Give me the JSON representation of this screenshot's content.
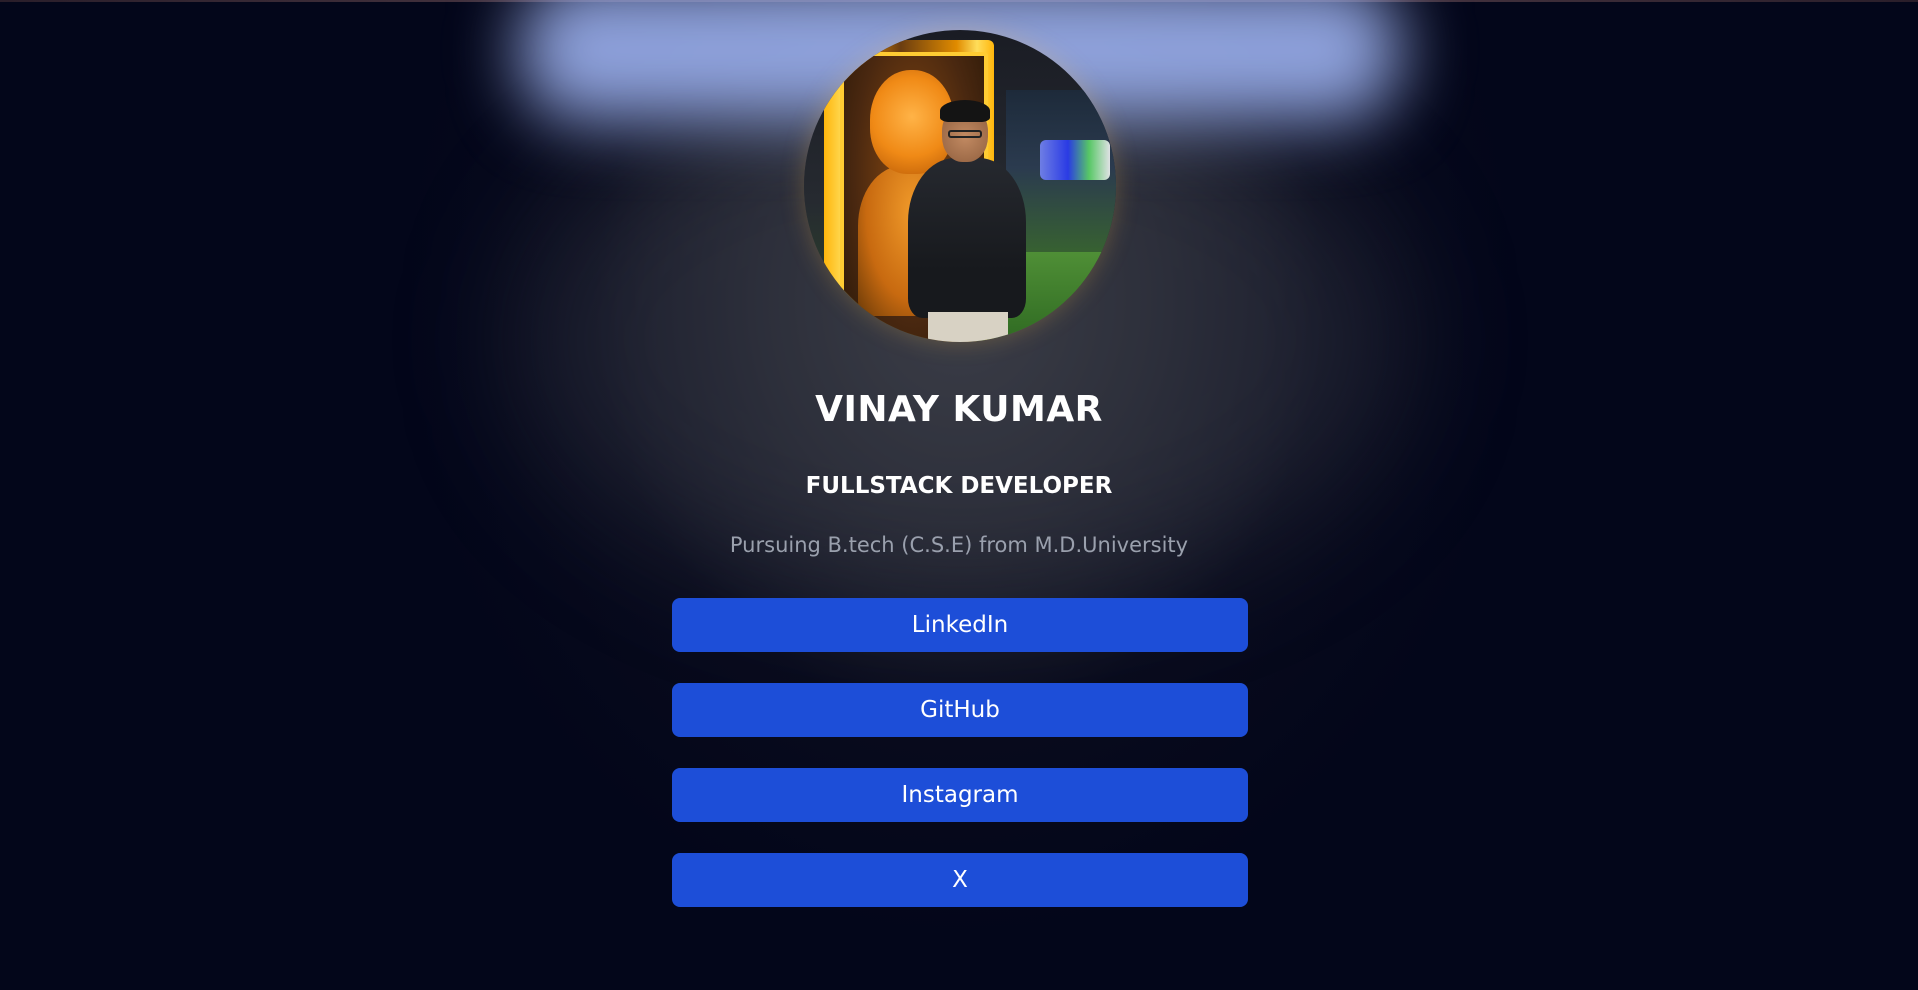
{
  "profile": {
    "name": "VINAY KUMAR",
    "role": "FULLSTACK DEVELOPER",
    "education": "Pursuing B.tech (C.S.E) from M.D.University"
  },
  "links": [
    {
      "label": "LinkedIn"
    },
    {
      "label": "GitHub"
    },
    {
      "label": "Instagram"
    },
    {
      "label": "X"
    }
  ],
  "colors": {
    "background": "#03061a",
    "button": "#1d4ed8",
    "name_text": "#ffffff",
    "education_text": "#9aa0ad"
  }
}
